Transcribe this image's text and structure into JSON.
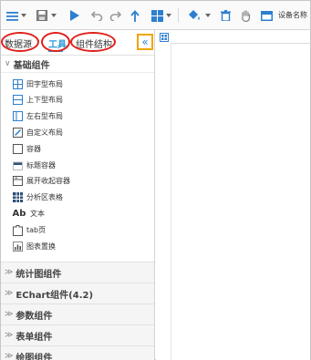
{
  "toolbar": {
    "device_label": "设备名称",
    "icons": [
      "menu-icon",
      "save-icon",
      "play-icon",
      "undo-icon",
      "redo-icon",
      "upload-icon",
      "layout-icon",
      "paint-bucket-icon",
      "delete-icon",
      "hand-icon",
      "device-icon"
    ]
  },
  "panel": {
    "tabs": [
      "数据源",
      "工具",
      "组件结构"
    ],
    "active_tab": "工具",
    "collapse_glyph": "«",
    "expanded_section": {
      "title": "基础组件",
      "items": [
        {
          "label": "田字型布局",
          "icon": "grid-layout-icon"
        },
        {
          "label": "上下型布局",
          "icon": "vertical-layout-icon"
        },
        {
          "label": "左右型布局",
          "icon": "horizontal-layout-icon"
        },
        {
          "label": "自定义布局",
          "icon": "custom-layout-icon"
        },
        {
          "label": "容器",
          "icon": "container-icon"
        },
        {
          "label": "标题容器",
          "icon": "title-container-icon"
        },
        {
          "label": "展开收起容器",
          "icon": "collapsible-container-icon"
        },
        {
          "label": "分析区表格",
          "icon": "table-icon"
        },
        {
          "label": "文本",
          "icon": "text-icon",
          "icon_text": "Ab"
        },
        {
          "label": "tab页",
          "icon": "tab-page-icon"
        },
        {
          "label": "图表置换",
          "icon": "chart-swap-icon"
        }
      ]
    },
    "collapsed_sections": [
      "统计图组件",
      "EChart组件(4.2)",
      "参数组件",
      "表单组件",
      "绘图组件"
    ]
  },
  "colors": {
    "accent": "#2d9cdb",
    "highlight_ring": "#e0201c",
    "collapse_border": "#f0a500"
  }
}
